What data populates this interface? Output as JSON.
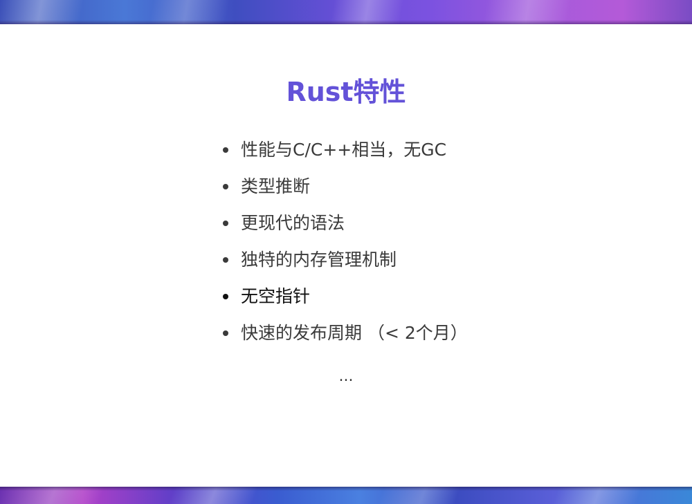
{
  "slide": {
    "title": "Rust特性",
    "bullets": [
      "性能与C/C++相当，无GC",
      "类型推断",
      "更现代的语法",
      "独特的内存管理机制",
      "无空指针",
      "快速的发布周期 （< 2个月）"
    ],
    "ellipsis": "...",
    "colors": {
      "title": "#6352d8",
      "text": "#3a3a3a"
    }
  }
}
